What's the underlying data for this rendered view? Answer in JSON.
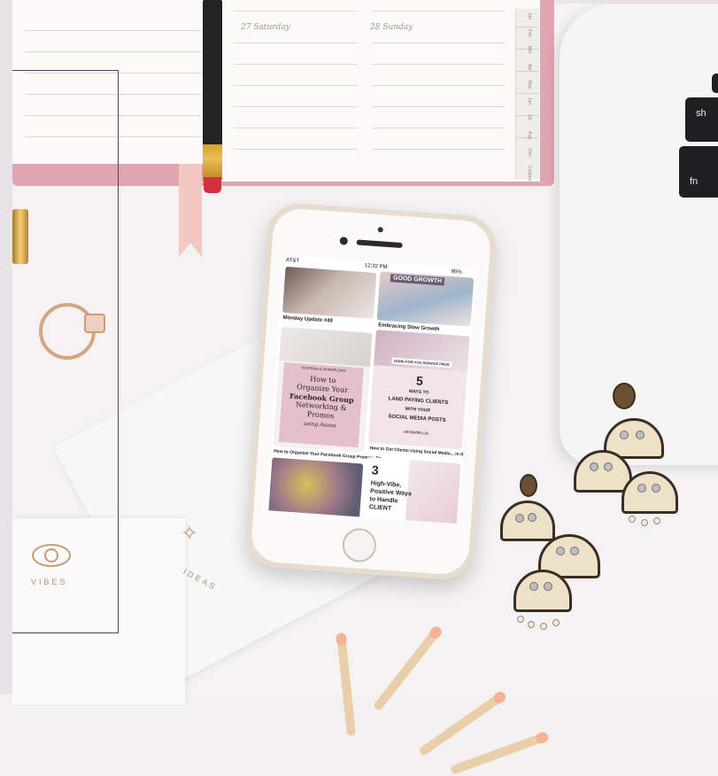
{
  "planner": {
    "day_left": "27 Saturday",
    "day_right": "28 Sunday",
    "tabs": [
      "Jan",
      "Feb",
      "Mar",
      "Apr",
      "May",
      "Jun",
      "Jul",
      "Aug",
      "Dec",
      "Contact"
    ]
  },
  "laptop": {
    "keys": [
      "sh",
      "fn"
    ]
  },
  "cards": {
    "front_label": "VIBES",
    "back_label": "IDEAS"
  },
  "phone": {
    "status_carrier": "AT&T",
    "status_time": "12:32 PM",
    "status_battery": "80%",
    "pins": {
      "p1_caption": "Monday Update #49",
      "p2_header": "GOOD GROWTH",
      "p2_caption": "Embracing Slow Growth",
      "p3_tag": "SYSTEMS & WORKFLOWS",
      "p3_line1": "How to",
      "p3_line2": "Organize Your",
      "p3_line3": "Facebook Group",
      "p3_line4": "Networking &",
      "p3_line5": "Promos",
      "p3_line6": "using Asana",
      "p3_caption": "How to Organize Your Facebook Group Promos, Po...",
      "p4_tag": "DONE-FOR-YOU SERVICE PROS",
      "p4_number": "5",
      "p4_line1": "WAYS TO",
      "p4_line2": "LAND PAYING CLIENTS",
      "p4_line3": "WITH YOUR",
      "p4_line4": "SOCIAL MEDIA POSTS",
      "p4_source": "serawiles.ca",
      "p4_caption": "How to Get Clients Using Social Media... In this post, I'...",
      "p6_number": "3",
      "p6_line1": "High-Vibe,",
      "p6_line2": "Positive Ways",
      "p6_line3": "to Handle",
      "p6_line4": "CLIENT"
    }
  },
  "colors": {
    "frame": "#5b3a64",
    "planner_cover": "#e0a7b0",
    "pin_pink": "#e8c7cf",
    "gold": "#c79c76"
  }
}
